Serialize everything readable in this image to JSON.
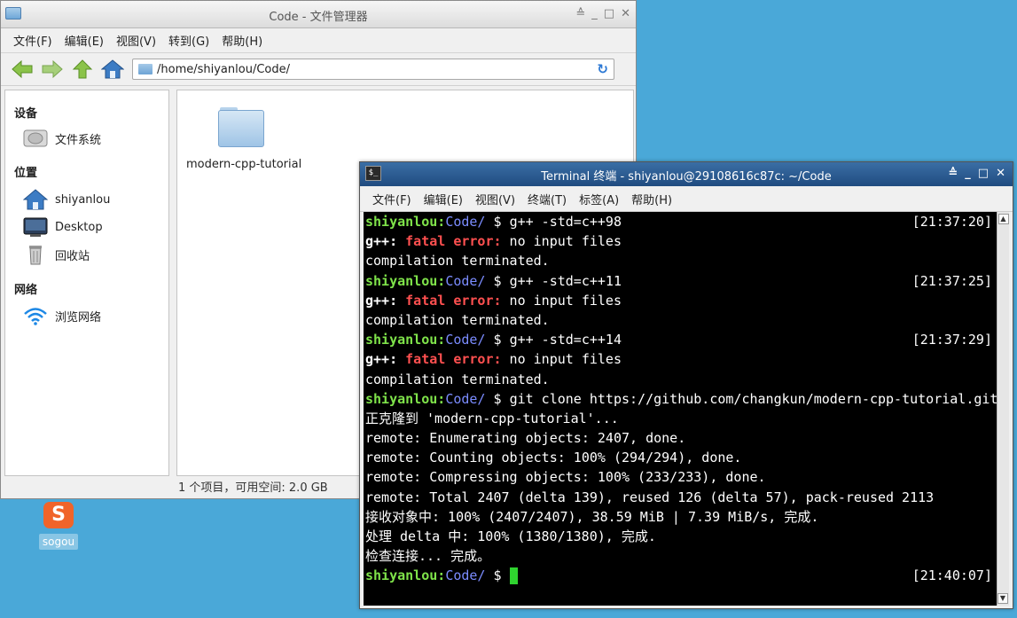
{
  "file_manager": {
    "title": "Code - 文件管理器",
    "window_buttons": [
      "≙",
      "_",
      "□",
      "✕"
    ],
    "menu": [
      "文件(F)",
      "编辑(E)",
      "视图(V)",
      "转到(G)",
      "帮助(H)"
    ],
    "path": "/home/shiyanlou/Code/",
    "sidebar": {
      "devices_heading": "设备",
      "devices": [
        {
          "label": "文件系统",
          "icon": "drive-icon"
        }
      ],
      "places_heading": "位置",
      "places": [
        {
          "label": "shiyanlou",
          "icon": "home-icon"
        },
        {
          "label": "Desktop",
          "icon": "desktop-icon"
        },
        {
          "label": "回收站",
          "icon": "trash-icon"
        }
      ],
      "network_heading": "网络",
      "network": [
        {
          "label": "浏览网络",
          "icon": "wifi-icon"
        }
      ]
    },
    "files": [
      {
        "name": "modern-cpp-tutorial",
        "icon": "folder-icon"
      }
    ],
    "status": "1 个项目，可用空间: 2.0 GB"
  },
  "desktop": {
    "icons": [
      {
        "label": "sogou",
        "icon": "sogou-icon",
        "glyph": "S"
      }
    ]
  },
  "terminal": {
    "title": "Terminal 终端 - shiyanlou@29108616c87c: ~/Code",
    "icon_text": "$_",
    "window_buttons": [
      "≙",
      "_",
      "□",
      "✕"
    ],
    "menu": [
      "文件(F)",
      "编辑(E)",
      "视图(V)",
      "终端(T)",
      "标签(A)",
      "帮助(H)"
    ],
    "prompt_user": "shiyanlou",
    "prompt_dir": "Code/",
    "prompt_symbol": " $ ",
    "lines": [
      {
        "type": "prompt",
        "cmd": "g++ -std=c++98",
        "time": "[21:37:20]"
      },
      {
        "type": "error",
        "prefix": "g++:",
        "err": "fatal error:",
        "msg": " no input files"
      },
      {
        "type": "text",
        "text": "compilation terminated."
      },
      {
        "type": "prompt",
        "cmd": "g++ -std=c++11",
        "time": "[21:37:25]"
      },
      {
        "type": "error",
        "prefix": "g++:",
        "err": "fatal error:",
        "msg": " no input files"
      },
      {
        "type": "text",
        "text": "compilation terminated."
      },
      {
        "type": "prompt",
        "cmd": "g++ -std=c++14",
        "time": "[21:37:29]"
      },
      {
        "type": "error",
        "prefix": "g++:",
        "err": "fatal error:",
        "msg": " no input files"
      },
      {
        "type": "text",
        "text": "compilation terminated."
      },
      {
        "type": "prompt",
        "cmd": "git clone https://github.com/changkun/modern-cpp-tutorial.git",
        "time": ""
      },
      {
        "type": "text",
        "text": "正克隆到 'modern-cpp-tutorial'..."
      },
      {
        "type": "text",
        "text": "remote: Enumerating objects: 2407, done."
      },
      {
        "type": "text",
        "text": "remote: Counting objects: 100% (294/294), done."
      },
      {
        "type": "text",
        "text": "remote: Compressing objects: 100% (233/233), done."
      },
      {
        "type": "text",
        "text": "remote: Total 2407 (delta 139), reused 126 (delta 57), pack-reused 2113"
      },
      {
        "type": "text",
        "text": "接收对象中: 100% (2407/2407), 38.59 MiB | 7.39 MiB/s, 完成."
      },
      {
        "type": "text",
        "text": "处理 delta 中: 100% (1380/1380), 完成."
      },
      {
        "type": "text",
        "text": "检查连接... 完成。"
      },
      {
        "type": "prompt_cursor",
        "cmd": "",
        "time": "[21:40:07]"
      }
    ]
  }
}
